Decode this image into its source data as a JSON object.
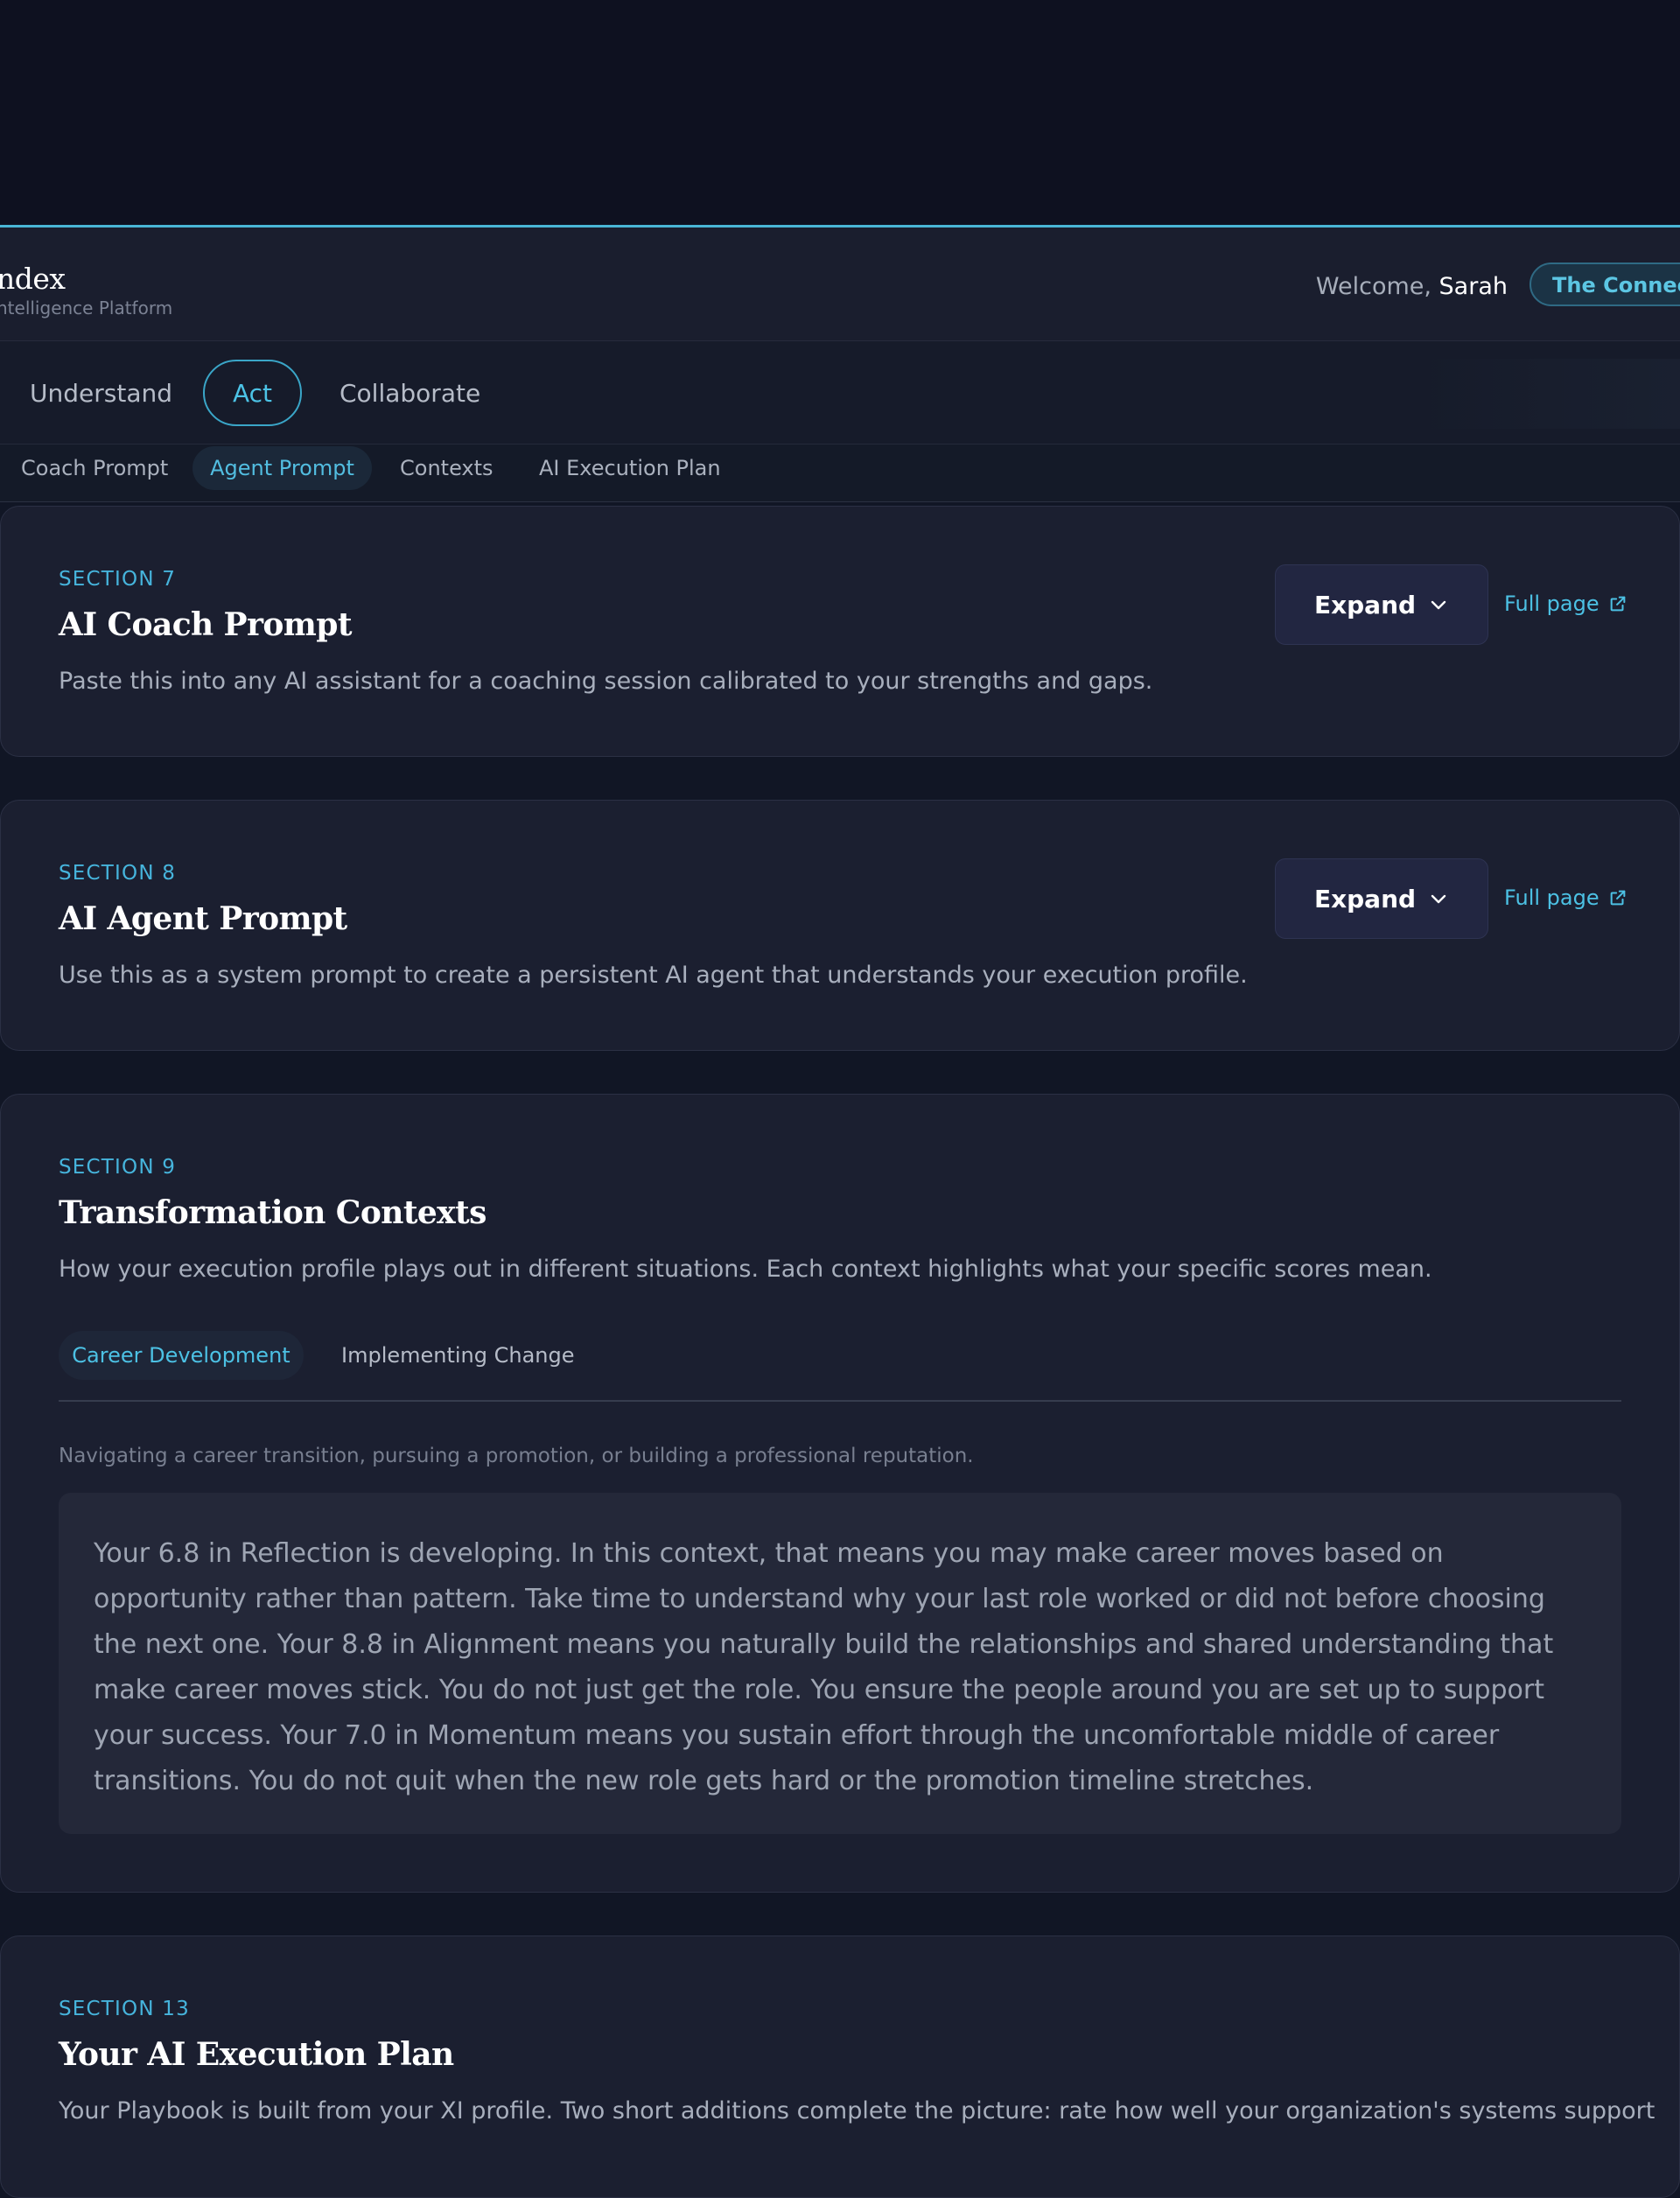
{
  "header": {
    "brand_name": "ndex",
    "brand_sub": "ntelligence Platform",
    "welcome_prefix": "Welcome, ",
    "user_name": "Sarah",
    "org_pill": "The Connect"
  },
  "primary_nav": {
    "tabs": [
      {
        "label": "Understand",
        "active": false
      },
      {
        "label": "Act",
        "active": true
      },
      {
        "label": "Collaborate",
        "active": false
      }
    ]
  },
  "sub_nav": {
    "tabs": [
      {
        "label": "Coach Prompt",
        "active": false
      },
      {
        "label": "Agent Prompt",
        "active": true
      },
      {
        "label": "Contexts",
        "active": false
      },
      {
        "label": "AI Execution Plan",
        "active": false
      }
    ]
  },
  "sections": [
    {
      "eyebrow": "SECTION 7",
      "title": "AI Coach Prompt",
      "description": "Paste this into any AI assistant for a coaching session calibrated to your strengths and gaps.",
      "expand_label": "Expand",
      "full_page_label": "Full page"
    },
    {
      "eyebrow": "SECTION 8",
      "title": "AI Agent Prompt",
      "description": "Use this as a system prompt to create a persistent AI agent that understands your execution profile.",
      "expand_label": "Expand",
      "full_page_label": "Full page"
    },
    {
      "eyebrow": "SECTION 9",
      "title": "Transformation Contexts",
      "description": "How your execution profile plays out in different situations. Each context highlights what your specific scores mean.",
      "context_tabs": [
        {
          "label": "Career Development",
          "active": true
        },
        {
          "label": "Implementing Change",
          "active": false
        }
      ],
      "context_caption": "Navigating a career transition, pursuing a promotion, or building a professional reputation.",
      "context_body": "Your 6.8 in Reflection is developing. In this context, that means you may make career moves based on opportunity rather than pattern. Take time to understand why your last role worked or did not before choosing the next one. Your 8.8 in Alignment means you naturally build the relationships and shared understanding that make career moves stick. You do not just get the role. You ensure the people around you are set up to support your success. Your 7.0 in Momentum means you sustain effort through the uncomfortable middle of career transitions. You do not quit when the new role gets hard or the promotion timeline stretches."
    },
    {
      "eyebrow": "SECTION 13",
      "title": "Your AI Execution Plan",
      "description": "Your Playbook is built from your XI profile. Two short additions complete the picture: rate how well your organization's systems support"
    }
  ],
  "colors": {
    "accent": "#49b6d6",
    "background": "#111625",
    "card": "#1b1f30",
    "button": "#222641"
  }
}
